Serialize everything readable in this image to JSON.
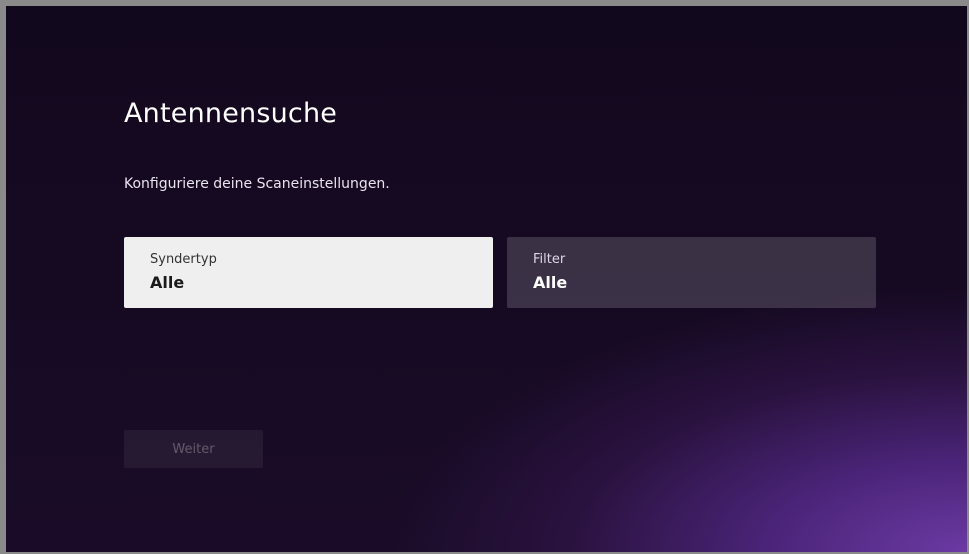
{
  "screen": {
    "title": "Antennensuche",
    "subtitle": "Konfiguriere deine Scaneinstellungen."
  },
  "settings": [
    {
      "label": "Syndertyp",
      "value": "Alle",
      "focused": true
    },
    {
      "label": "Filter",
      "value": "Alle",
      "focused": false
    }
  ],
  "continue_button": {
    "label": "Weiter",
    "enabled": false
  },
  "colors": {
    "focused_tile": "#efefef",
    "background_dark": "#12081d",
    "background_accent": "#6b3aa3"
  }
}
